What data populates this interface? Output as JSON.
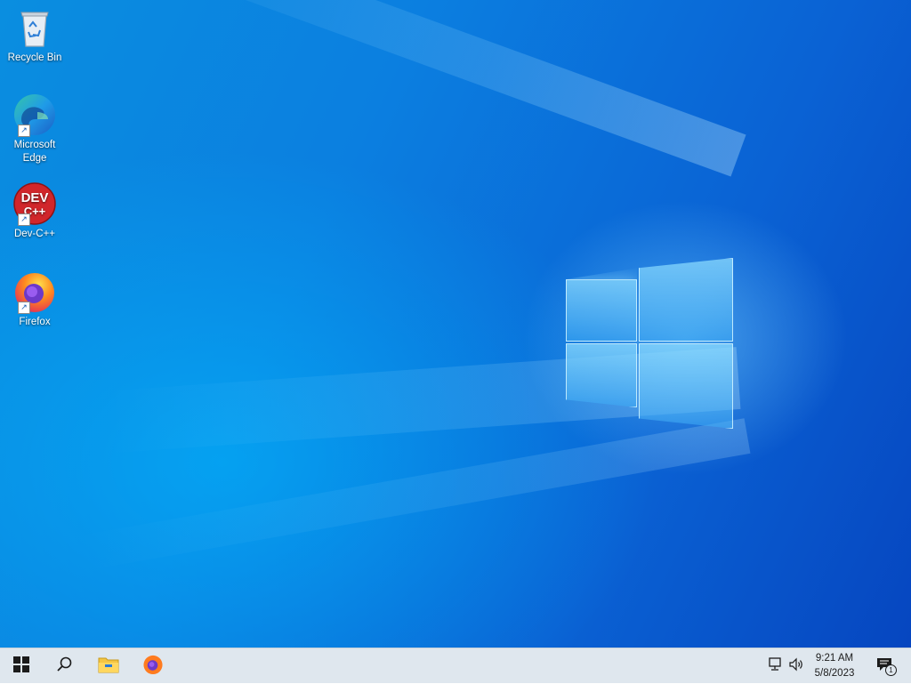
{
  "desktop": {
    "icons": [
      {
        "label": "Recycle Bin",
        "icon": "recycle-bin-icon"
      },
      {
        "label": "Microsoft Edge",
        "icon": "edge-icon"
      },
      {
        "label": "Dev-C++",
        "icon": "dev-cpp-icon",
        "icon_text_top": "DEV",
        "icon_text_bottom": "C++"
      },
      {
        "label": "Firefox",
        "icon": "firefox-icon"
      }
    ]
  },
  "taskbar": {
    "start": {
      "icon": "windows-start-icon"
    },
    "search": {
      "icon": "search-icon"
    },
    "pinned": [
      {
        "icon": "file-explorer-icon"
      },
      {
        "icon": "firefox-icon"
      }
    ],
    "tray": {
      "network_icon": "network-icon",
      "volume_icon": "volume-icon",
      "time": "9:21 AM",
      "date": "5/8/2023",
      "notifications_icon": "action-center-icon",
      "notifications_count": "1"
    }
  },
  "colors": {
    "desktop_accent": "#0a7fe0",
    "taskbar_bg": "#dfe7ee"
  }
}
